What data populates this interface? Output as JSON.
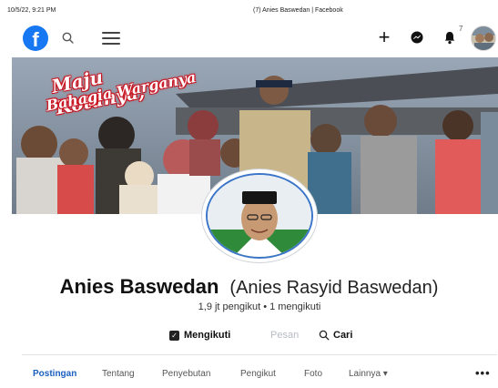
{
  "print_header": {
    "date": "10/5/22, 9:21 PM",
    "title": "(7) Anies Baswedan | Facebook"
  },
  "topbar": {
    "logo_letter": "f",
    "notification_count": "7",
    "icons": [
      "facebook-logo",
      "search-icon",
      "menu-icon",
      "plus-icon",
      "messenger-icon",
      "bell-icon"
    ]
  },
  "cover": {
    "slogan_line1": "Maju Kotanya,",
    "slogan_line2": "Bahagia Warganya"
  },
  "profile": {
    "name": "Anies Baswedan",
    "alternate_name": "(Anies Rasyid Baswedan)",
    "followers": "1,9 jt pengikut • 1 mengikuti"
  },
  "actions": {
    "follow_label": "Mengikuti",
    "message_label": "Pesan",
    "search_label": "Cari"
  },
  "tabs": [
    {
      "label": "Postingan",
      "active": true
    },
    {
      "label": "Tentang",
      "active": false
    },
    {
      "label": "Penyebutan",
      "active": false
    },
    {
      "label": "Pengikut",
      "active": false
    },
    {
      "label": "Foto",
      "active": false
    },
    {
      "label": "Lainnya ▾",
      "active": false
    }
  ],
  "tabs_more": "•••",
  "colors": {
    "facebook_blue": "#1877f2",
    "active_tab": "#1b5fc1",
    "slogan_red": "#c1121f"
  }
}
